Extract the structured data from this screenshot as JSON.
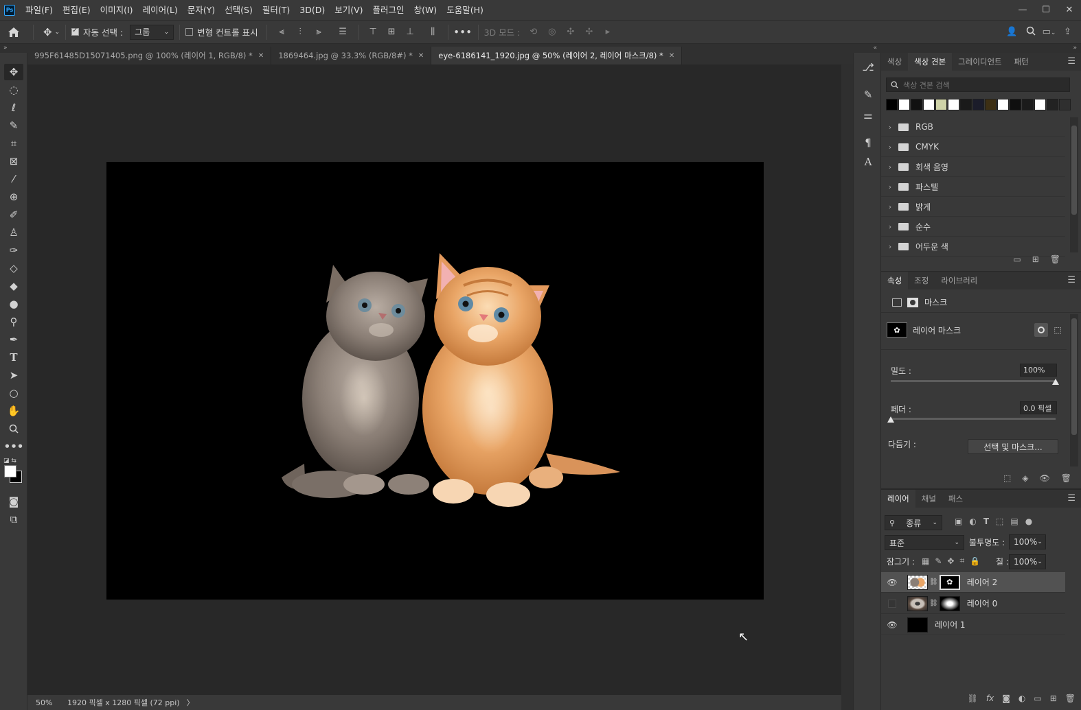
{
  "app": {
    "logo": "Ps",
    "menu": [
      "파일(F)",
      "편집(E)",
      "이미지(I)",
      "레이어(L)",
      "문자(Y)",
      "선택(S)",
      "필터(T)",
      "3D(D)",
      "보기(V)",
      "플러그인",
      "창(W)",
      "도움말(H)"
    ],
    "window_controls": [
      "—",
      "☐",
      "✕"
    ]
  },
  "options": {
    "auto_select_label": "자동 선택 :",
    "auto_select_checked": true,
    "auto_select_value": "그룹",
    "transform_controls_label": "변형 컨트롤 표시",
    "transform_controls_checked": false,
    "more": "•••",
    "mode_3d_label": "3D 모드 :"
  },
  "tabs": [
    {
      "label": "995F61485D15071405.png @ 100% (레이어 1, RGB/8) *",
      "active": false
    },
    {
      "label": "1869464.jpg @ 33.3% (RGB/8#) *",
      "active": false
    },
    {
      "label": "eye-6186141_1920.jpg @ 50% (레이어 2, 레이어 마스크/8) *",
      "active": true
    }
  ],
  "status": {
    "zoom": "50%",
    "doc_info": "1920 픽셀 x 1280 픽셀 (72 ppi)",
    "arrow": "〉"
  },
  "swatches_panel": {
    "tabs": [
      "색상",
      "색상 견본",
      "그레이디언트",
      "패턴"
    ],
    "active_tab": "색상 견본",
    "search_placeholder": "색상 견본 검색",
    "swatch_colors": [
      "#000000",
      "#ffffff",
      "#111111",
      "#ffffff",
      "#cfd3a8",
      "#ffffff",
      "#1a1a1a",
      "#1b1c2a",
      "#3d2f14",
      "#ffffff",
      "#0f0f0f",
      "#1b1b1b",
      "#ffffff",
      "#222222",
      "#2f2f2f"
    ],
    "groups": [
      "RGB",
      "CMYK",
      "회색 음영",
      "파스텔",
      "밝게",
      "순수",
      "어두운 색"
    ]
  },
  "properties_panel": {
    "tabs": [
      "속성",
      "조정",
      "라이브러리"
    ],
    "active_tab": "속성",
    "mask_label": "마스크",
    "layer_mask_label": "레이어 마스크",
    "density_label": "밀도 :",
    "density_value": "100%",
    "density_fraction": 1.0,
    "feather_label": "페더 :",
    "feather_value": "0.0 픽셀",
    "feather_fraction": 0.0,
    "refine_label": "다듬기 :",
    "refine_button": "선택 및 마스크..."
  },
  "layers_panel": {
    "tabs": [
      "레이어",
      "채널",
      "패스"
    ],
    "active_tab": "레이어",
    "filter_label": "종류",
    "blend_mode": "표준",
    "opacity_label": "불투명도 :",
    "opacity_value": "100%",
    "lock_label": "잠그기 :",
    "fill_label": "칠 :",
    "fill_value": "100%",
    "layers": [
      {
        "name": "레이어 2",
        "visible": true,
        "selected": true,
        "has_mask": true
      },
      {
        "name": "레이어 0",
        "visible": false,
        "selected": false,
        "has_mask": true
      },
      {
        "name": "레이어 1",
        "visible": true,
        "selected": false,
        "has_mask": false
      }
    ]
  },
  "colors": {
    "accent": "#31a8ff",
    "panel_bg": "#393939",
    "canvas_bg": "#282828",
    "document_bg": "#000000",
    "kitten_gray": "#8a7e75",
    "kitten_orange": "#e9a566"
  }
}
